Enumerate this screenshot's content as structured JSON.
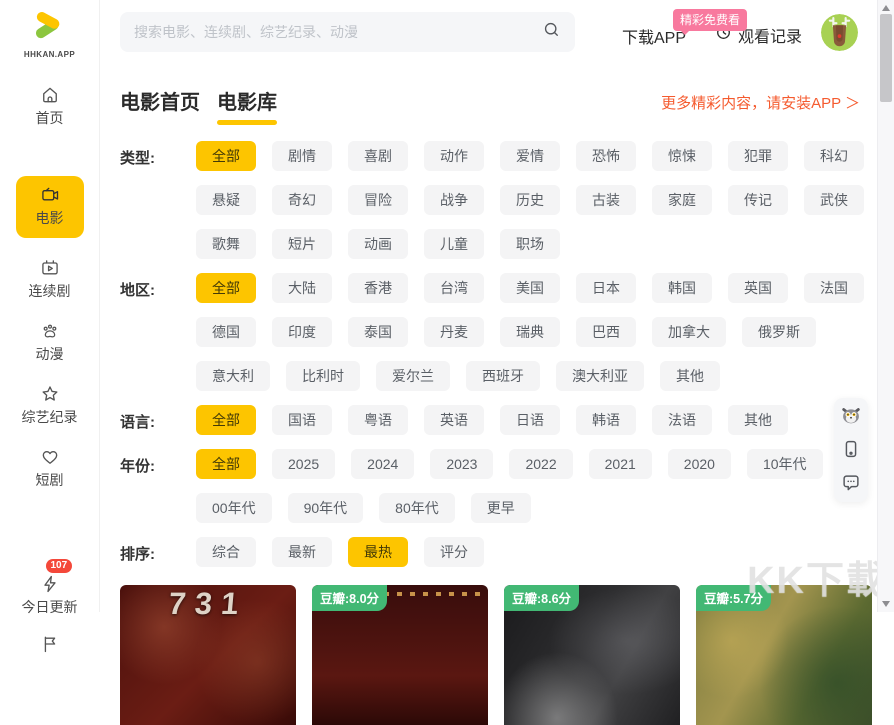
{
  "colors": {
    "accent_yellow": "#fdc500",
    "brand_green": "#8cc63f",
    "promo_pink": "#f8799e",
    "link_orange": "#f55b2f",
    "rating_green": "#42b874",
    "badge_red": "#f4483a"
  },
  "logo": {
    "text": "HHKAN.APP"
  },
  "topbar": {
    "search_placeholder": "搜索电影、连续剧、综艺纪录、动漫",
    "search_value": "",
    "download_app": "下载APP",
    "promo_badge": "精彩免费看",
    "watch_history": "观看记录"
  },
  "sidebar": {
    "items": [
      {
        "type": "link",
        "key": "home",
        "icon": "home-icon",
        "label": "首页"
      },
      {
        "type": "divider"
      },
      {
        "type": "link",
        "key": "movies",
        "icon": "movie-camera-icon",
        "label": "电影",
        "selected": true
      },
      {
        "type": "link",
        "key": "series",
        "icon": "tv-play-icon",
        "label": "连续剧"
      },
      {
        "type": "link",
        "key": "anime",
        "icon": "paw-icon",
        "label": "动漫"
      },
      {
        "type": "link",
        "key": "variety",
        "icon": "star-icon",
        "label": "综艺纪录"
      },
      {
        "type": "link",
        "key": "shorts",
        "icon": "heart-icon",
        "label": "短剧"
      },
      {
        "type": "divider"
      },
      {
        "type": "link",
        "key": "today-update",
        "icon": "lightning-icon",
        "label": "今日更新",
        "badge": "107"
      },
      {
        "type": "link",
        "key": "flag",
        "icon": "flag-icon",
        "label": ""
      }
    ]
  },
  "main": {
    "tabs": [
      {
        "label": "电影首页",
        "active": false
      },
      {
        "label": "电影库",
        "active": true
      }
    ],
    "app_link": "更多精彩内容，请安装APP ＞"
  },
  "filters": [
    {
      "key": "type",
      "label": "类型:",
      "selected": "全部",
      "rows": [
        [
          "全部",
          "剧情",
          "喜剧",
          "动作",
          "爱情",
          "恐怖",
          "惊悚",
          "犯罪",
          "科幻"
        ],
        [
          "悬疑",
          "奇幻",
          "冒险",
          "战争",
          "历史",
          "古装",
          "家庭",
          "传记",
          "武侠"
        ],
        [
          "歌舞",
          "短片",
          "动画",
          "儿童",
          "职场"
        ]
      ]
    },
    {
      "key": "region",
      "label": "地区:",
      "selected": "全部",
      "rows": [
        [
          "全部",
          "大陆",
          "香港",
          "台湾",
          "美国",
          "日本",
          "韩国",
          "英国",
          "法国"
        ],
        [
          "德国",
          "印度",
          "泰国",
          "丹麦",
          "瑞典",
          "巴西",
          "加拿大",
          "俄罗斯"
        ],
        [
          "意大利",
          "比利时",
          "爱尔兰",
          "西班牙",
          "澳大利亚",
          "其他"
        ]
      ]
    },
    {
      "key": "language",
      "label": "语言:",
      "selected": "全部",
      "rows": [
        [
          "全部",
          "国语",
          "粤语",
          "英语",
          "日语",
          "韩语",
          "法语",
          "其他"
        ]
      ]
    },
    {
      "key": "year",
      "label": "年份:",
      "selected": "全部",
      "rows": [
        [
          "全部",
          "2025",
          "2024",
          "2023",
          "2022",
          "2021",
          "2020",
          "10年代"
        ],
        [
          "00年代",
          "90年代",
          "80年代",
          "更早"
        ]
      ]
    },
    {
      "key": "sort",
      "label": "排序:",
      "selected": "最热",
      "rows": [
        [
          "综合",
          "最新",
          "最热",
          "评分"
        ]
      ]
    }
  ],
  "posters": [
    {
      "title": "731",
      "rating": null,
      "theme": "maroon"
    },
    {
      "title": null,
      "rating": "豆瓣:8.0分",
      "theme": "darkred"
    },
    {
      "title": null,
      "rating": "豆瓣:8.6分",
      "theme": "dark"
    },
    {
      "title": null,
      "rating": "豆瓣:5.7分",
      "theme": "olive"
    }
  ],
  "watermark": "KK下載"
}
